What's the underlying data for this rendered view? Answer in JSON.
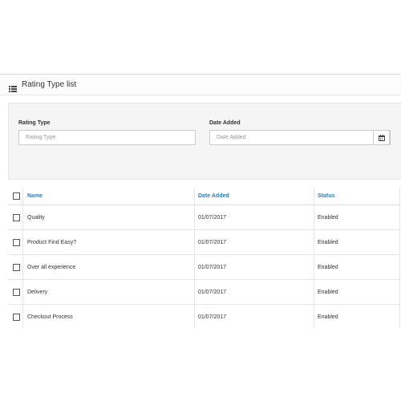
{
  "panel": {
    "title": "Rating Type list",
    "icon": "list-icon"
  },
  "filters": {
    "rating_type": {
      "label": "Rating Type",
      "placeholder": "Rating Type"
    },
    "date_added": {
      "label": "Date Added",
      "placeholder": "Date Added",
      "icon": "calendar-icon"
    }
  },
  "table": {
    "headers": {
      "name": "Name",
      "date_added": "Date Added",
      "status": "Status"
    },
    "rows": [
      {
        "name": "Quality",
        "date_added": "01/07/2017",
        "status": "Enabled"
      },
      {
        "name": "Product Find Easy?",
        "date_added": "01/07/2017",
        "status": "Enabled"
      },
      {
        "name": "Over all experience",
        "date_added": "01/07/2017",
        "status": "Enabled"
      },
      {
        "name": "Delivery",
        "date_added": "01/07/2017",
        "status": "Enabled"
      },
      {
        "name": "Checkout Process",
        "date_added": "01/07/2017",
        "status": "Enabled"
      }
    ]
  },
  "colors": {
    "link": "#2a7fc2",
    "filter_bg": "#f5f5f5"
  }
}
